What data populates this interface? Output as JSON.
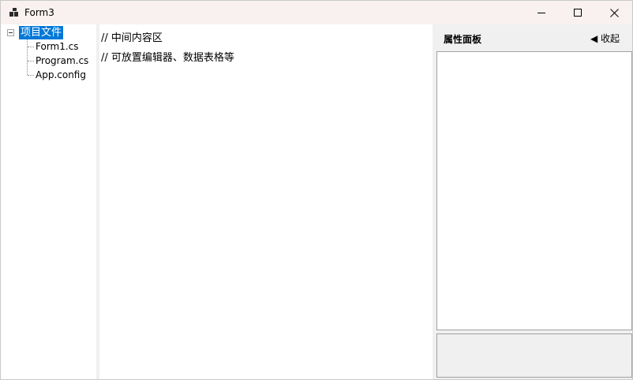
{
  "window": {
    "title": "Form3"
  },
  "tree": {
    "root_label": "项目文件",
    "children": [
      "Form1.cs",
      "Program.cs",
      "App.config"
    ]
  },
  "content": {
    "lines": [
      "//  中间内容区",
      "//  可放置编辑器、数据表格等"
    ]
  },
  "property_panel": {
    "title": "属性面板",
    "collapse_label": "◀ 收起"
  },
  "colors": {
    "selection": "#0078d7",
    "titlebar": "#f8f1ef",
    "panel": "#f0f0f0"
  }
}
